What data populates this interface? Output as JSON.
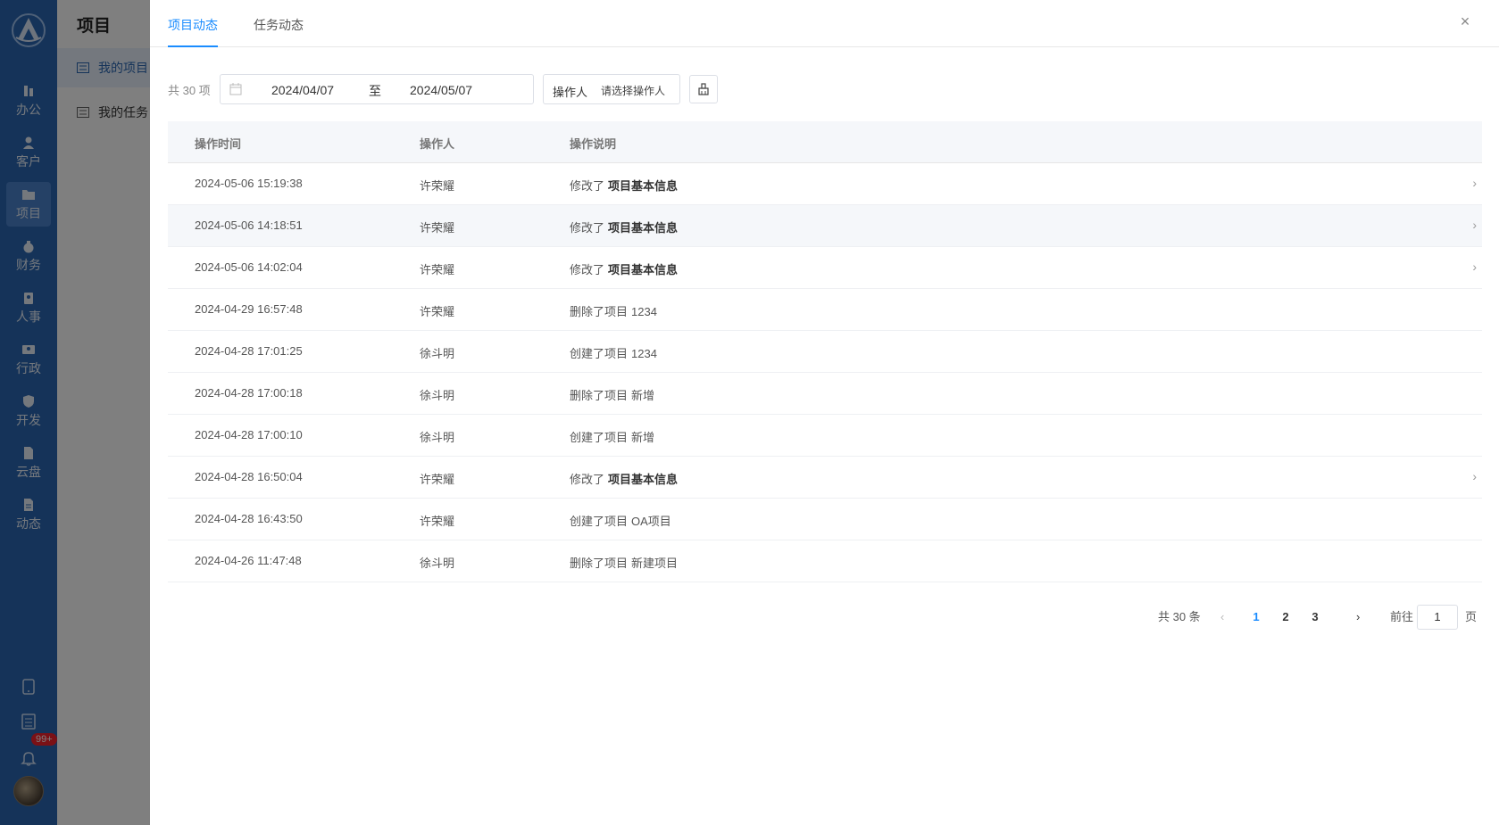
{
  "rail": {
    "items": [
      {
        "label": "办公",
        "icon": "office-icon"
      },
      {
        "label": "客户",
        "icon": "customer-icon"
      },
      {
        "label": "项目",
        "icon": "folder-icon"
      },
      {
        "label": "财务",
        "icon": "money-bag-icon"
      },
      {
        "label": "人事",
        "icon": "badge-icon"
      },
      {
        "label": "行政",
        "icon": "id-card-icon"
      },
      {
        "label": "开发",
        "icon": "shield-icon"
      },
      {
        "label": "云盘",
        "icon": "cloud-file-icon"
      },
      {
        "label": "动态",
        "icon": "document-icon"
      }
    ],
    "active_index": 2,
    "notification_badge": "99+"
  },
  "submenu": {
    "title": "项目",
    "items": [
      {
        "label": "我的项目"
      },
      {
        "label": "我的任务"
      }
    ]
  },
  "drawer": {
    "tabs": [
      {
        "label": "项目动态"
      },
      {
        "label": "任务动态"
      }
    ],
    "close_label": "×",
    "filter": {
      "count_text": "共 30 项",
      "start_date": "2024/04/07",
      "separator": "至",
      "end_date": "2024/05/07",
      "operator_label": "操作人",
      "operator_placeholder": "请选择操作人"
    },
    "table": {
      "headers": [
        "操作时间",
        "操作人",
        "操作说明"
      ],
      "rows": [
        {
          "time": "2024-05-06 15:19:38",
          "user": "许荣耀",
          "action": "修改了",
          "target": "项目基本信息",
          "bold": true,
          "arrow": true
        },
        {
          "time": "2024-05-06 14:18:51",
          "user": "许荣耀",
          "action": "修改了",
          "target": "项目基本信息",
          "bold": true,
          "arrow": true
        },
        {
          "time": "2024-05-06 14:02:04",
          "user": "许荣耀",
          "action": "修改了",
          "target": "项目基本信息",
          "bold": true,
          "arrow": true
        },
        {
          "time": "2024-04-29 16:57:48",
          "user": "许荣耀",
          "action": "删除了项目",
          "target": "1234",
          "bold": false,
          "arrow": false
        },
        {
          "time": "2024-04-28 17:01:25",
          "user": "徐斗明",
          "action": "创建了项目",
          "target": "1234",
          "bold": false,
          "arrow": false
        },
        {
          "time": "2024-04-28 17:00:18",
          "user": "徐斗明",
          "action": "删除了项目",
          "target": "新增",
          "bold": false,
          "arrow": false
        },
        {
          "time": "2024-04-28 17:00:10",
          "user": "徐斗明",
          "action": "创建了项目",
          "target": "新增",
          "bold": false,
          "arrow": false
        },
        {
          "time": "2024-04-28 16:50:04",
          "user": "许荣耀",
          "action": "修改了",
          "target": "项目基本信息",
          "bold": true,
          "arrow": true
        },
        {
          "time": "2024-04-28 16:43:50",
          "user": "许荣耀",
          "action": "创建了项目",
          "target": "OA项目",
          "bold": false,
          "arrow": false
        },
        {
          "time": "2024-04-26 11:47:48",
          "user": "徐斗明",
          "action": "删除了项目",
          "target": "新建项目",
          "bold": false,
          "arrow": false
        }
      ]
    },
    "pagination": {
      "total_text": "共 30 条",
      "pages": [
        "1",
        "2",
        "3"
      ],
      "current": "1",
      "goto_label": "前往",
      "goto_value": "1",
      "page_suffix": "页"
    }
  },
  "colors": {
    "rail_bg": "#2b67b3",
    "accent": "#1a8cff",
    "badge": "#f5222d"
  }
}
